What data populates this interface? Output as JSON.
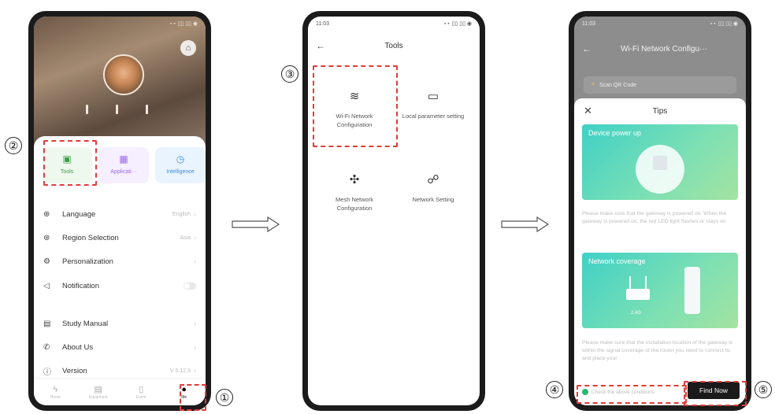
{
  "step_numbers": [
    "①",
    "②",
    "③",
    "④",
    "⑤"
  ],
  "phone1": {
    "status_time": "",
    "status_icons": "⋆⋆ ▯▯ ▯▯ ◉",
    "tiles": [
      {
        "label": "Tools",
        "icon": "tools-icon",
        "color": "#3b9e44"
      },
      {
        "label": "Applicati···",
        "icon": "grid-icon",
        "color": "#a066e8"
      },
      {
        "label": "Intelligence",
        "icon": "clock-icon",
        "color": "#3a8de0"
      }
    ],
    "menu": [
      {
        "label": "Language",
        "value": "English",
        "icon": "globe-icon"
      },
      {
        "label": "Region Selection",
        "value": "Asia",
        "icon": "region-icon"
      },
      {
        "label": "Personalization",
        "value": "",
        "icon": "settings-icon"
      },
      {
        "label": "Notification",
        "value": "",
        "icon": "speaker-icon"
      },
      {
        "label": "Study Manual",
        "value": "",
        "icon": "manual-icon"
      },
      {
        "label": "About Us",
        "value": "",
        "icon": "phone-icon"
      },
      {
        "label": "Version",
        "value": "V 5.12.5",
        "icon": "info-icon"
      }
    ],
    "tabs": [
      {
        "label": "Home",
        "icon": "lightning-icon"
      },
      {
        "label": "Equipment",
        "icon": "equipment-icon"
      },
      {
        "label": "Event",
        "icon": "document-icon"
      },
      {
        "label": "Me",
        "icon": "person-icon"
      }
    ]
  },
  "phone2": {
    "status_time": "11:03",
    "status_icons": "⋆⋆ ▯▯ ▯▯ ◉",
    "title": "Tools",
    "tools": [
      {
        "label": "Wi-Fi Network Configuration",
        "icon": "wifi-icon"
      },
      {
        "label": "Local parameter setting",
        "icon": "window-icon"
      },
      {
        "label": "Mesh Network Configuration",
        "icon": "mesh-icon"
      },
      {
        "label": "Network Setting",
        "icon": "globe-link-icon"
      }
    ]
  },
  "phone3": {
    "status_time": "11:03",
    "status_icons": "⋆⋆ ▯▯ ▯▯ ◉",
    "title": "Wi-Fi Network Configu···",
    "scan_label": "Scan QR Code",
    "tips_title": "Tips",
    "banner1_title": "Device power up",
    "tip1": "Please make sure that the gateway is powered on. When the gateway is powered on, the red LED light flashes or stays on",
    "banner2_title": "Network coverage",
    "banner2_label": "2.4G",
    "tip2": "Please make sure that the installation location of the gateway is within the signal coverage of the router you need to connect to, and place your",
    "check_label": "Check the above conditions",
    "find_now": "Find Now"
  },
  "colors": {
    "highlight": "#e23b3b",
    "accent_teal": "#3fd1c6",
    "check_green": "#2bb673"
  }
}
